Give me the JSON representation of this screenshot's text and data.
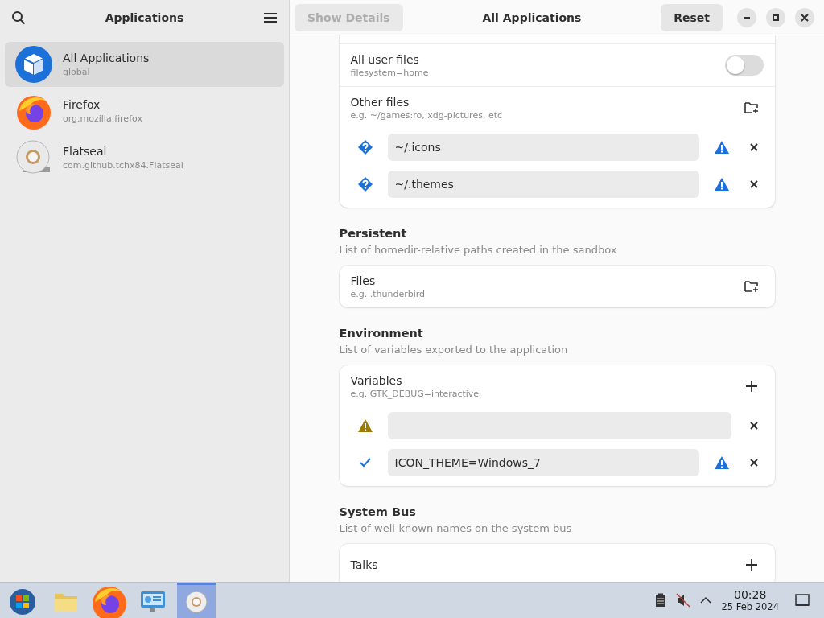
{
  "sidebar": {
    "title": "Applications",
    "items": [
      {
        "name": "All Applications",
        "id": "global",
        "kind": "box",
        "selected": true
      },
      {
        "name": "Firefox",
        "id": "org.mozilla.firefox",
        "kind": "firefox",
        "selected": false
      },
      {
        "name": "Flatseal",
        "id": "com.github.tchx84.Flatseal",
        "kind": "seal",
        "selected": false
      }
    ]
  },
  "header": {
    "details_button": {
      "label": "Show Details",
      "disabled": true
    },
    "title": "All Applications",
    "reset_button": {
      "label": "Reset"
    }
  },
  "sections": [
    {
      "rows": [
        {
          "kind": "switch",
          "title": "All user files",
          "subtitle": "filesystem=home",
          "on": false
        },
        {
          "kind": "list",
          "title": "Other files",
          "subtitle": "e.g. ~/games:ro, xdg-pictures, etc",
          "action": {
            "kind": "folder"
          },
          "entries": [
            {
              "value": "~/.icons",
              "kind": "question",
              "flagged": true
            },
            {
              "value": "~/.themes",
              "kind": "question",
              "flagged": true
            }
          ]
        }
      ]
    },
    {
      "heading": "Persistent",
      "description": "List of homedir-relative paths created in the sandbox",
      "rows": [
        {
          "kind": "list",
          "title": "Files",
          "subtitle": "e.g. .thunderbird",
          "action": {
            "kind": "folder"
          }
        }
      ]
    },
    {
      "heading": "Environment",
      "description": "List of variables exported to the application",
      "rows": [
        {
          "kind": "list",
          "title": "Variables",
          "subtitle": "e.g. GTK_DEBUG=interactive",
          "action": {
            "kind": "add"
          },
          "entries": [
            {
              "kind": "warning",
              "flagged": false
            },
            {
              "value": "ICON_THEME=Windows_7",
              "kind": "ok",
              "flagged": true
            }
          ]
        }
      ]
    },
    {
      "heading": "System Bus",
      "description": "List of well-known names on the system bus",
      "rows": [
        {
          "kind": "list",
          "title": "Talks",
          "action": {
            "kind": "add"
          }
        }
      ]
    }
  ],
  "taskbar": {
    "apps": [
      {
        "kind": "start",
        "selected": false
      },
      {
        "kind": "folder",
        "selected": false
      },
      {
        "kind": "firefox",
        "selected": false
      },
      {
        "kind": "settings",
        "selected": false
      },
      {
        "kind": "seal",
        "selected": true
      }
    ],
    "time": "00:28",
    "date": "25 Feb 2024"
  }
}
